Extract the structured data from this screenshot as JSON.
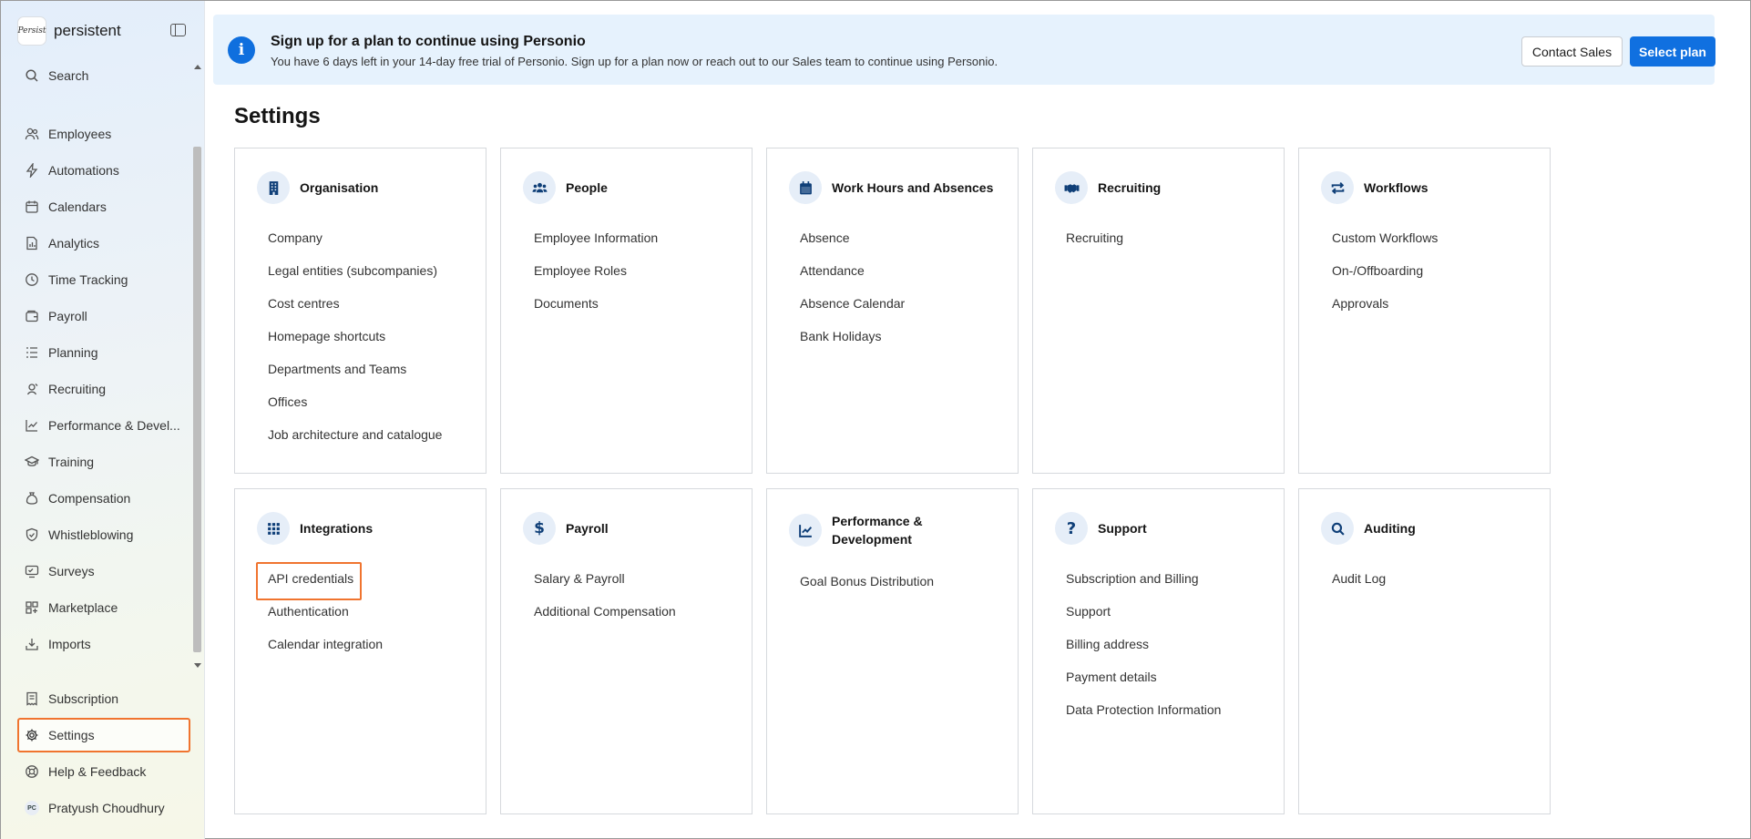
{
  "brand": {
    "name": "persistent",
    "logo_text": "Persist"
  },
  "sidebar": {
    "search_label": "Search",
    "items": [
      {
        "label": "Employees",
        "icon": "people-icon"
      },
      {
        "label": "Automations",
        "icon": "lightning-icon"
      },
      {
        "label": "Calendars",
        "icon": "calendar-icon"
      },
      {
        "label": "Analytics",
        "icon": "document-chart-icon"
      },
      {
        "label": "Time Tracking",
        "icon": "clock-icon"
      },
      {
        "label": "Payroll",
        "icon": "wallet-icon"
      },
      {
        "label": "Planning",
        "icon": "list-icon"
      },
      {
        "label": "Recruiting",
        "icon": "recruiting-icon"
      },
      {
        "label": "Performance & Devel...",
        "icon": "chart-line-icon"
      },
      {
        "label": "Training",
        "icon": "graduation-cap-icon"
      },
      {
        "label": "Compensation",
        "icon": "money-bag-icon"
      },
      {
        "label": "Whistleblowing",
        "icon": "shield-icon"
      },
      {
        "label": "Surveys",
        "icon": "survey-icon"
      },
      {
        "label": "Marketplace",
        "icon": "grid-plus-icon"
      },
      {
        "label": "Imports",
        "icon": "download-box-icon"
      }
    ],
    "bottom": [
      {
        "label": "Subscription",
        "icon": "receipt-icon"
      },
      {
        "label": "Settings",
        "icon": "gear-icon",
        "active": true
      },
      {
        "label": "Help & Feedback",
        "icon": "lifebuoy-icon"
      },
      {
        "label": "Pratyush Choudhury",
        "icon": "avatar",
        "initials": "PC"
      }
    ]
  },
  "banner": {
    "title": "Sign up for a plan to continue using Personio",
    "text": "You have 6 days left in your 14-day free trial of Personio. Sign up for a plan now or reach out to our Sales team to continue using Personio.",
    "contact_label": "Contact Sales",
    "select_label": "Select plan",
    "accent_color": "#1070e0"
  },
  "page_title": "Settings",
  "cards": [
    {
      "title": "Organisation",
      "icon": "building-icon",
      "links": [
        "Company",
        "Legal entities (subcompanies)",
        "Cost centres",
        "Homepage shortcuts",
        "Departments and Teams",
        "Offices",
        "Job architecture and catalogue"
      ]
    },
    {
      "title": "People",
      "icon": "people-group-icon",
      "links": [
        "Employee Information",
        "Employee Roles",
        "Documents"
      ]
    },
    {
      "title": "Work Hours and Absences",
      "icon": "calendar-icon",
      "links": [
        "Absence",
        "Attendance",
        "Absence Calendar",
        "Bank Holidays"
      ]
    },
    {
      "title": "Recruiting",
      "icon": "handshake-icon",
      "links": [
        "Recruiting"
      ]
    },
    {
      "title": "Workflows",
      "icon": "repeat-icon",
      "links": [
        "Custom Workflows",
        "On-/Offboarding",
        "Approvals"
      ]
    },
    {
      "title": "Integrations",
      "icon": "grid-icon",
      "links": [
        "API credentials",
        "Authentication",
        "Calendar integration"
      ]
    },
    {
      "title": "Payroll",
      "icon": "dollar-icon",
      "links": [
        "Salary & Payroll",
        "Additional Compensation"
      ]
    },
    {
      "title": "Performance & Development",
      "icon": "chart-line-icon",
      "links": [
        "Goal Bonus Distribution"
      ]
    },
    {
      "title": "Support",
      "icon": "question-icon",
      "links": [
        "Subscription and Billing",
        "Support",
        "Billing address",
        "Payment details",
        "Data Protection Information"
      ]
    },
    {
      "title": "Auditing",
      "icon": "search-icon",
      "links": [
        "Audit Log"
      ]
    }
  ],
  "highlight_color": "#f0742f"
}
